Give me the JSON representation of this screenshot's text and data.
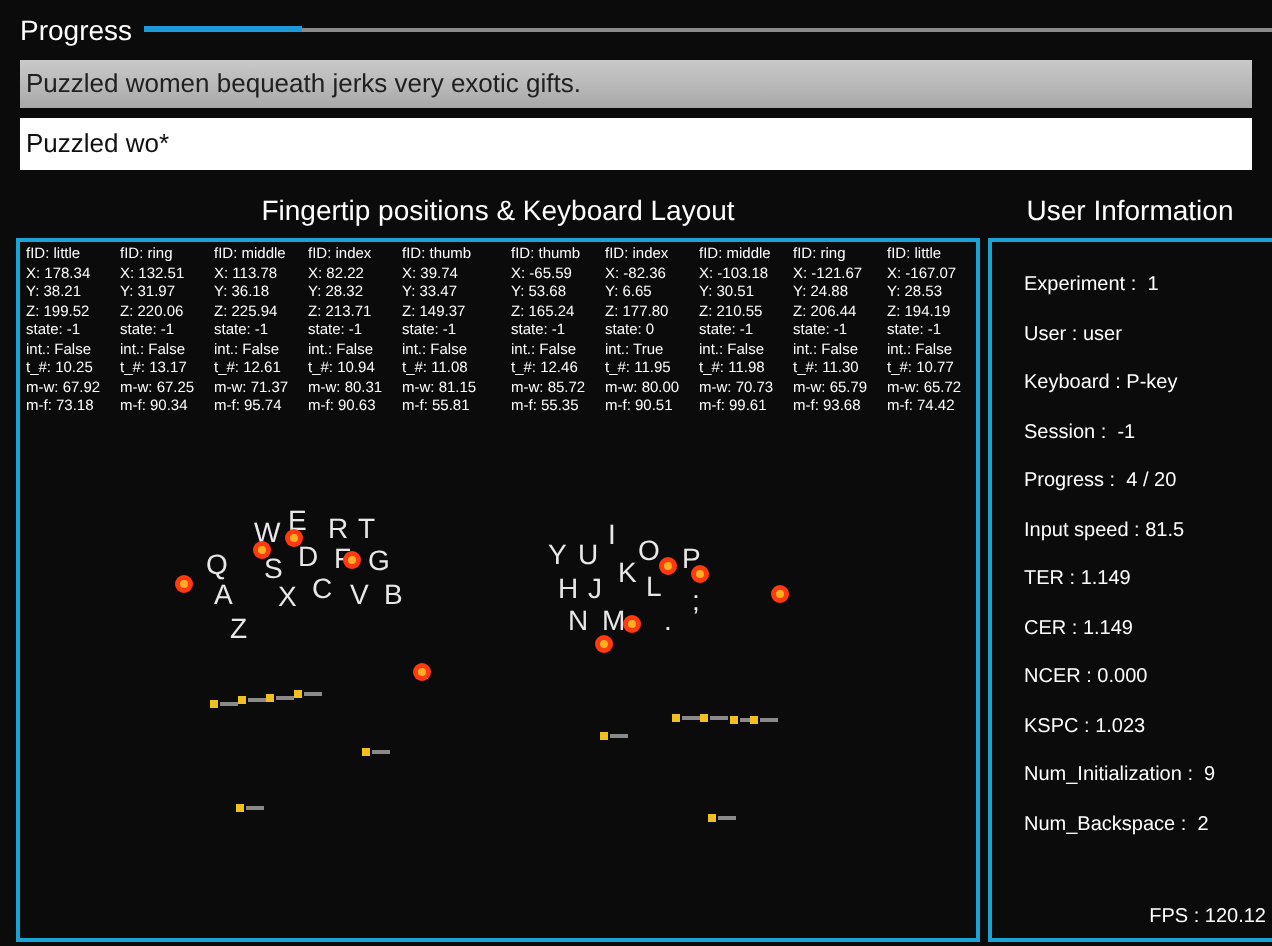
{
  "progress": {
    "label": "Progress",
    "level": 0.14
  },
  "target_sentence": "Puzzled women bequeath jerks very exotic gifts.",
  "input": {
    "value": "Puzzled wo*"
  },
  "keyboard_panel": {
    "title": "Fingertip positions & Keyboard Layout",
    "finger_groups": [
      [
        [
          "fID: little",
          "X: 178.34",
          "Y: 38.21",
          "Z: 199.52",
          "state: -1",
          "int.: False",
          "t_#: 10.25",
          "m-w: 67.92",
          "m-f: 73.18"
        ],
        [
          "fID: ring",
          "X: 132.51",
          "Y: 31.97",
          "Z: 220.06",
          "state: -1",
          "int.: False",
          "t_#: 13.17",
          "m-w: 67.25",
          "m-f: 90.34"
        ],
        [
          "fID: middle",
          "X: 113.78",
          "Y: 36.18",
          "Z: 225.94",
          "state: -1",
          "int.: False",
          "t_#: 12.61",
          "m-w: 71.37",
          "m-f: 95.74"
        ],
        [
          "fID: index",
          "X: 82.22",
          "Y: 28.32",
          "Z: 213.71",
          "state: -1",
          "int.: False",
          "t_#: 10.94",
          "m-w: 80.31",
          "m-f: 90.63"
        ],
        [
          "fID: thumb",
          "X: 39.74",
          "Y: 33.47",
          "Z: 149.37",
          "state: -1",
          "int.: False",
          "t_#: 11.08",
          "m-w: 81.15",
          "m-f: 55.81"
        ]
      ],
      [
        [
          "fID: thumb",
          "X: -65.59",
          "Y: 53.68",
          "Z: 165.24",
          "state: -1",
          "int.: False",
          "t_#: 12.46",
          "m-w: 85.72",
          "m-f: 55.35"
        ],
        [
          "fID: index",
          "X: -82.36",
          "Y: 6.65",
          "Z: 177.80",
          "state:  0",
          "int.: True",
          "t_#: 11.95",
          "m-w: 80.00",
          "m-f: 90.51"
        ],
        [
          "fID: middle",
          "X: -103.18",
          "Y: 30.51",
          "Z: 210.55",
          "state: -1",
          "int.: False",
          "t_#: 11.98",
          "m-w: 70.73",
          "m-f: 99.61"
        ],
        [
          "fID: ring",
          "X: -121.67",
          "Y: 24.88",
          "Z: 206.44",
          "state: -1",
          "int.: False",
          "t_#: 11.30",
          "m-w: 65.79",
          "m-f: 93.68"
        ],
        [
          "fID: little",
          "X: -167.07",
          "Y: 28.53",
          "Z: 194.19",
          "state: -1",
          "int.: False",
          "t_#: 10.77",
          "m-w: 65.72",
          "m-f: 74.42"
        ]
      ]
    ],
    "keys": [
      "W",
      "E",
      "R",
      "T",
      "Q",
      "S",
      "D",
      "F",
      "G",
      "A",
      "X",
      "C",
      "V",
      "B",
      "Z",
      "Y",
      "U",
      "I",
      "O",
      "P",
      "H",
      "J",
      "K",
      "L",
      "N",
      "M",
      ";",
      "."
    ]
  },
  "user_info": {
    "title": "User Information",
    "items": [
      "Experiment :  1",
      "User : user",
      "Keyboard : P-key",
      "Session :  -1",
      "Progress :  4 / 20",
      "Input speed : 81.5",
      "TER : 1.149",
      "CER : 1.149",
      "NCER : 0.000",
      "KSPC : 1.023",
      "Num_Initialization :  9",
      "Num_Backspace :  2"
    ],
    "fps": "FPS : 120.12"
  }
}
